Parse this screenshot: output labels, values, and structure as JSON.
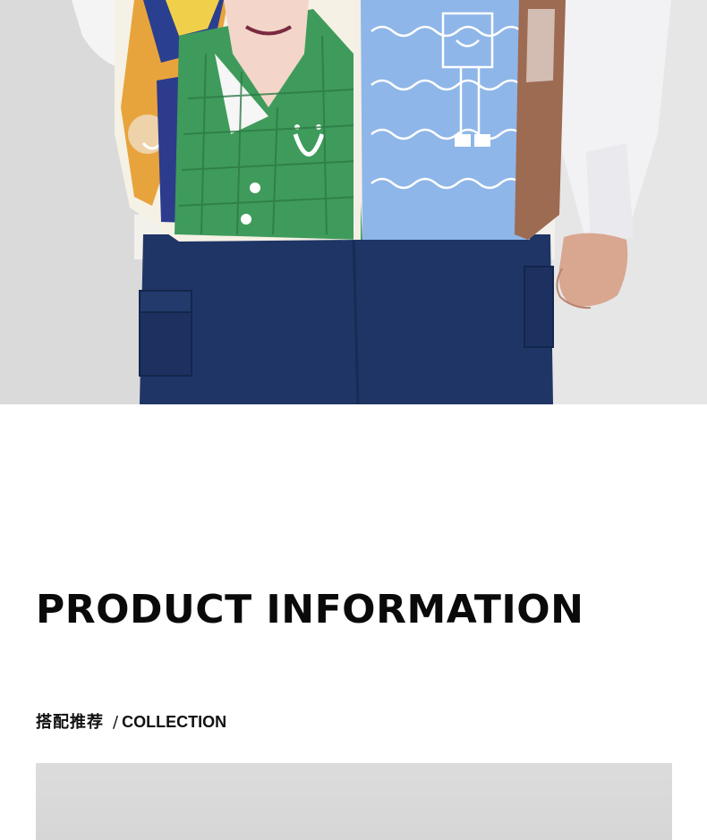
{
  "hero": {
    "image": "product-photo-graffiti-print-vest",
    "background_color": "#dedede"
  },
  "product_info": {
    "title": "PRODUCT INFORMATION"
  },
  "collection": {
    "label_cn": "搭配推荐",
    "separator": "/",
    "label_en": "COLLECTION",
    "image": "collection-photo"
  }
}
